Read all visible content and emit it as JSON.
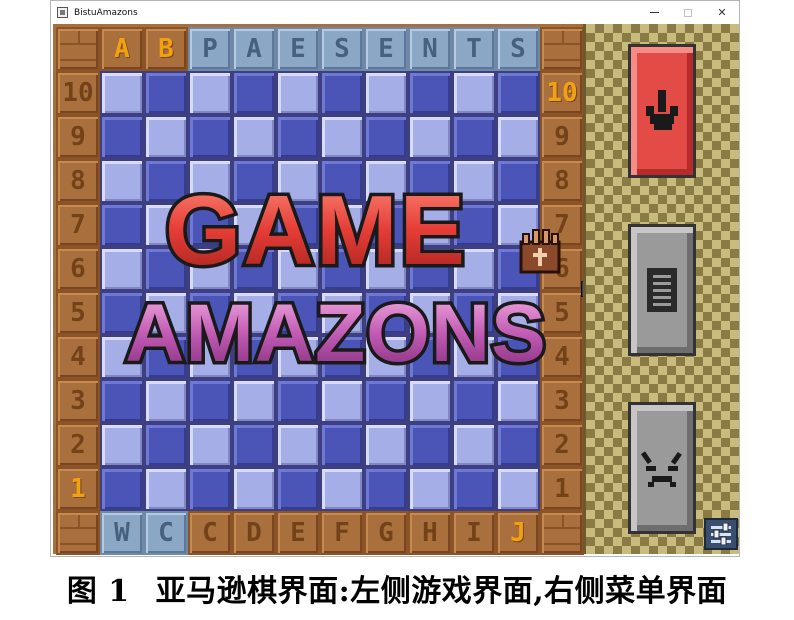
{
  "window": {
    "title": "BistuAmazons"
  },
  "board": {
    "top_letters": [
      "A",
      "B",
      "P",
      "A",
      "E",
      "S",
      "E",
      "N",
      "T",
      "S"
    ],
    "bottom_letters": [
      "W",
      "C",
      "C",
      "D",
      "E",
      "F",
      "G",
      "H",
      "I",
      "J"
    ],
    "left_numbers": [
      "10",
      "9",
      "8",
      "7",
      "6",
      "5",
      "4",
      "3",
      "2",
      "1"
    ],
    "right_numbers": [
      "10",
      "9",
      "8",
      "7",
      "6",
      "5",
      "4",
      "3",
      "2",
      "1"
    ]
  },
  "logo": {
    "line1": "GAME",
    "line2": "AMAZONS"
  },
  "menu": {
    "play_icon": "hand-pointer-icon",
    "doc_icon": "document-icon",
    "exit_icon": "burst-face-icon",
    "settings_icon": "sliders-icon"
  },
  "caption": {
    "figure": "图 1",
    "text": "亚马逊棋界面:左侧游戏界面,右侧菜单界面"
  }
}
